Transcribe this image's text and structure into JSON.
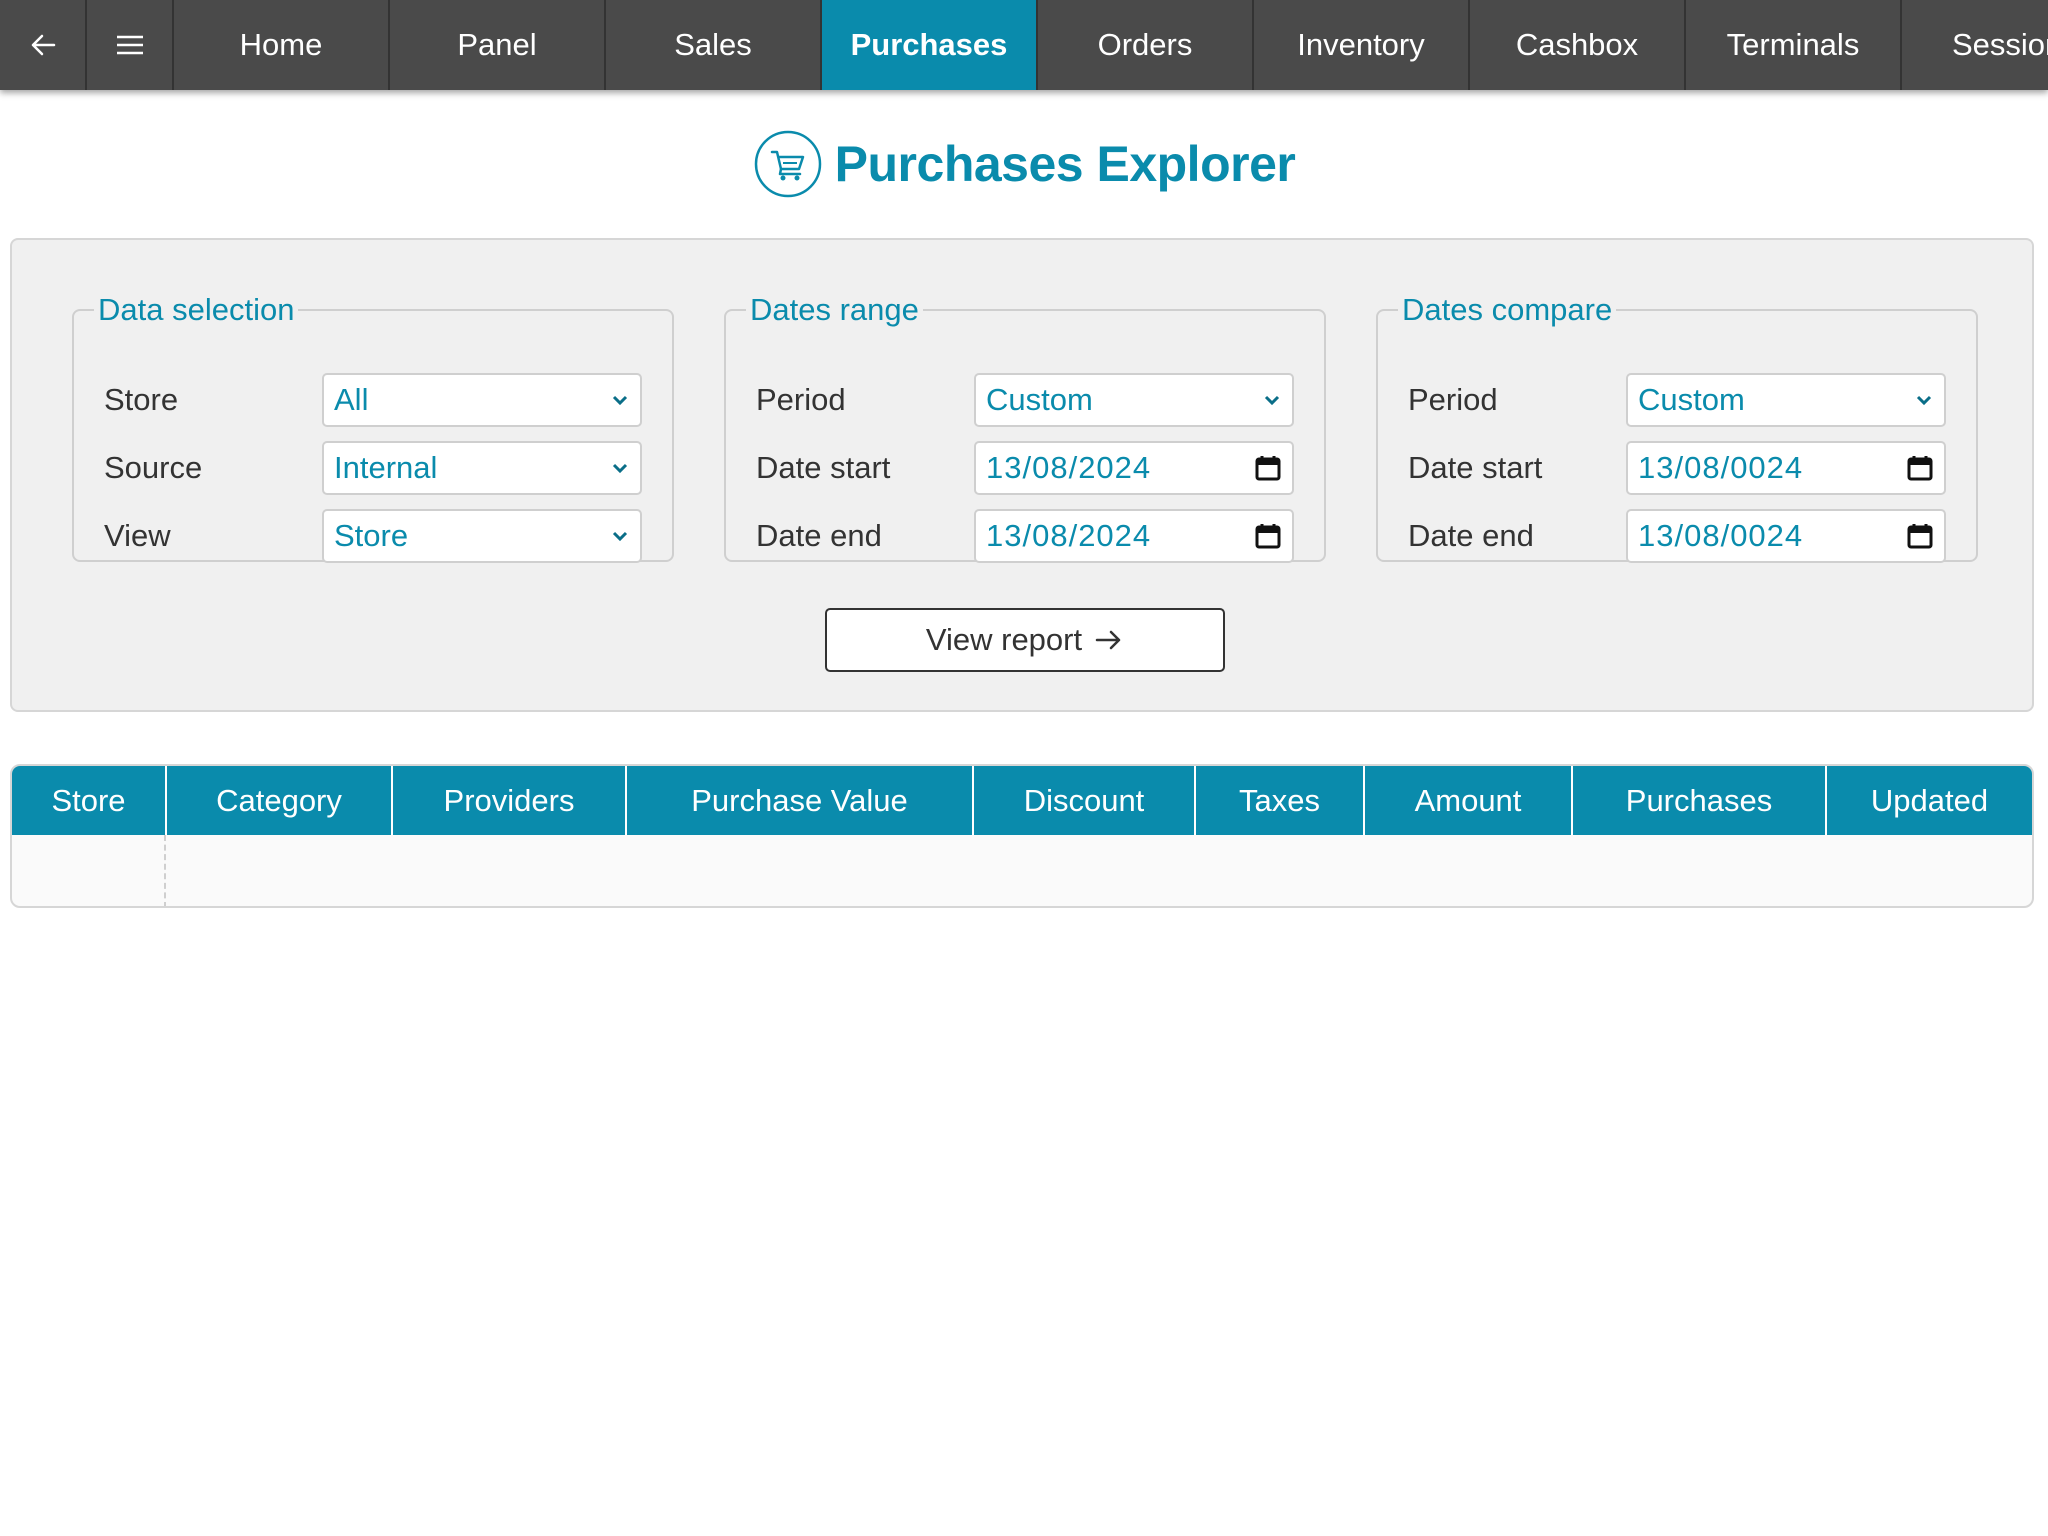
{
  "nav": {
    "back_icon": "arrow-left-icon",
    "menu_icon": "hamburger-menu-icon",
    "tabs": [
      {
        "label": "Home"
      },
      {
        "label": "Panel"
      },
      {
        "label": "Sales"
      },
      {
        "label": "Purchases",
        "active": true
      },
      {
        "label": "Orders"
      },
      {
        "label": "Inventory"
      },
      {
        "label": "Cashbox"
      },
      {
        "label": "Terminals"
      },
      {
        "label": "Session"
      }
    ]
  },
  "page": {
    "title": "Purchases Explorer",
    "title_icon": "shopping-cart-icon"
  },
  "filters": {
    "data_selection": {
      "legend": "Data selection",
      "store_label": "Store",
      "store_value": "All",
      "source_label": "Source",
      "source_value": "Internal",
      "view_label": "View",
      "view_value": "Store"
    },
    "dates_range": {
      "legend": "Dates range",
      "period_label": "Period",
      "period_value": "Custom",
      "start_label": "Date start",
      "start_value": "13/08/2024",
      "end_label": "Date end",
      "end_value": "13/08/2024"
    },
    "dates_compare": {
      "legend": "Dates compare",
      "period_label": "Period",
      "period_value": "Custom",
      "start_label": "Date start",
      "start_value": "13/08/0024",
      "end_label": "Date end",
      "end_value": "13/08/0024"
    },
    "view_report_label": "View report"
  },
  "table": {
    "columns": [
      "Store",
      "Category",
      "Providers",
      "Purchase Value",
      "Discount",
      "Taxes",
      "Amount",
      "Purchases",
      "Updated"
    ],
    "rows": []
  },
  "colors": {
    "accent": "#0a8bac",
    "nav_bg": "#4a4a4a",
    "panel_bg": "#f0f0f0"
  }
}
